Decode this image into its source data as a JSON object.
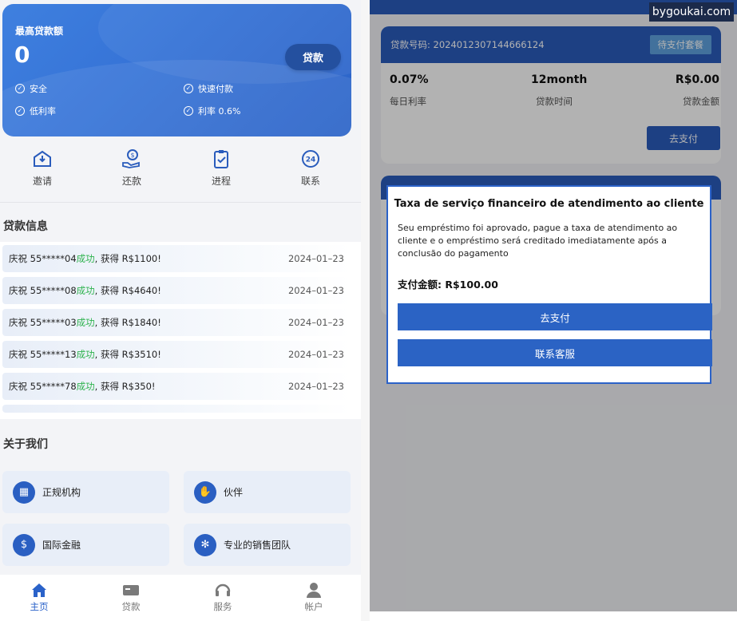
{
  "loan_card": {
    "title": "最高贷款额",
    "amount": "0",
    "button": "贷款",
    "features": [
      "安全",
      "快速付款",
      "低利率",
      "利率 0.6%"
    ]
  },
  "quick_actions": [
    {
      "label": "邀请",
      "icon": "invite-icon"
    },
    {
      "label": "还款",
      "icon": "repay-icon"
    },
    {
      "label": "进程",
      "icon": "progress-icon"
    },
    {
      "label": "联系",
      "icon": "contact-24h-icon"
    }
  ],
  "loan_info": {
    "title": "贷款信息",
    "rows": [
      {
        "prefix": "庆祝 55*****04 ",
        "status": "成功",
        "suffix": ", 获得 R$1100!",
        "date": "2024–01–23"
      },
      {
        "prefix": "庆祝 55*****08 ",
        "status": "成功",
        "suffix": ", 获得 R$4640!",
        "date": "2024–01–23"
      },
      {
        "prefix": "庆祝 55*****03 ",
        "status": "成功",
        "suffix": ", 获得 R$1840!",
        "date": "2024–01–23"
      },
      {
        "prefix": "庆祝 55*****13 ",
        "status": "成功",
        "suffix": ", 获得 R$3510!",
        "date": "2024–01–23"
      },
      {
        "prefix": "庆祝 55*****78 ",
        "status": "成功",
        "suffix": ", 获得 R$350!",
        "date": "2024–01–23"
      }
    ]
  },
  "about": {
    "title": "关于我们",
    "items": [
      {
        "label": "正规机构",
        "icon": "institution-icon"
      },
      {
        "label": "伙伴",
        "icon": "handshake-icon"
      },
      {
        "label": "国际金融",
        "icon": "finance-icon"
      },
      {
        "label": "专业的销售团队",
        "icon": "team-icon"
      }
    ]
  },
  "tabbar": [
    {
      "label": "主页",
      "icon": "home-icon",
      "active": true
    },
    {
      "label": "贷款",
      "icon": "card-icon",
      "active": false
    },
    {
      "label": "服务",
      "icon": "headset-icon",
      "active": false
    },
    {
      "label": "帐户",
      "icon": "user-icon",
      "active": false
    }
  ],
  "order": {
    "number_label": "贷款号码: 2024012307144666124",
    "status": "待支付套餐",
    "daily_rate": "0.07%",
    "daily_rate_label": "每日利率",
    "term": "12month",
    "term_label": "贷款时间",
    "amount": "R$0.00",
    "amount_label": "贷款金额",
    "pay_button": "去支付"
  },
  "modal": {
    "title": "Taxa de serviço financeiro de atendimento ao cliente",
    "body": "Seu empréstimo foi aprovado, pague a taxa de atendimento ao cliente e o empréstimo será creditado imediatamente após a conclusão do pagamento",
    "amount_label": "支付金额: R$100.00",
    "pay_button": "去支付",
    "contact_button": "联系客服"
  },
  "watermark": "bygoukai.com",
  "colors": {
    "primary": "#2a5cbc",
    "success": "#2fb34f",
    "card_gradient_start": "#3f80df"
  }
}
